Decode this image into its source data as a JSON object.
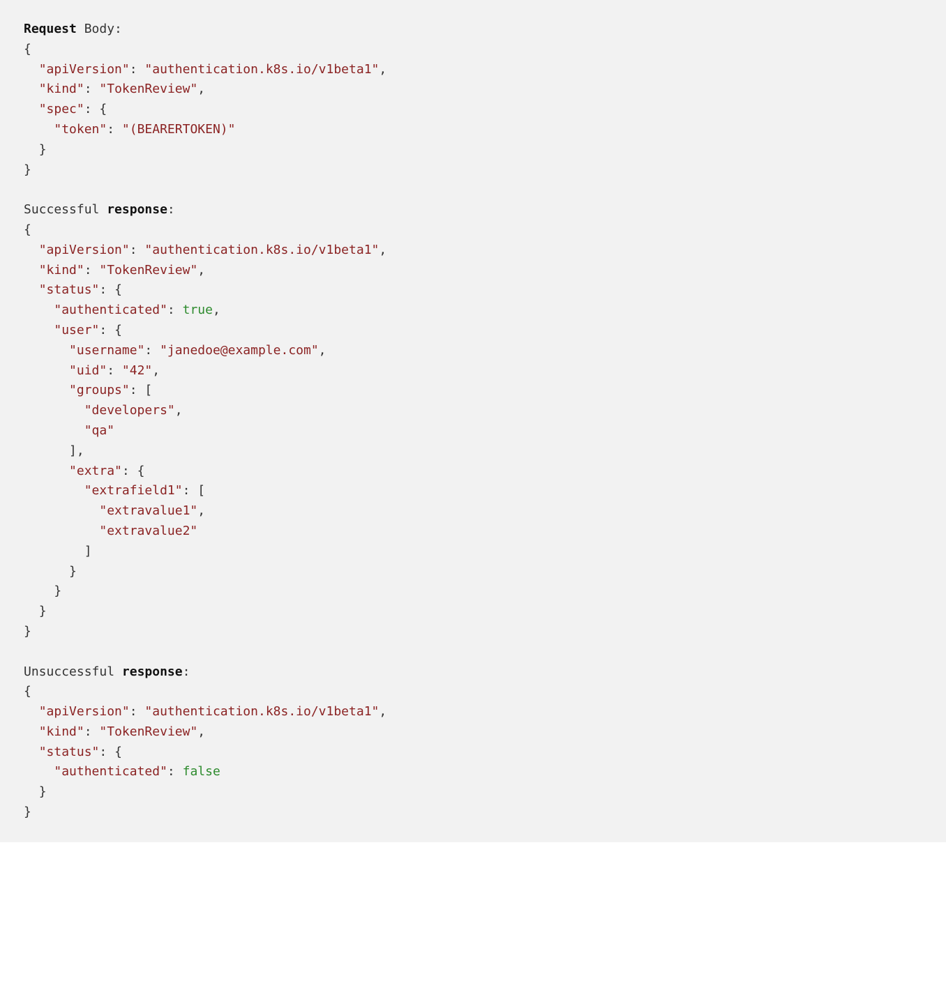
{
  "header1_bold": "Request",
  "header1_rest": " Body:",
  "header2_pre": "Successful ",
  "header2_bold": "response",
  "header2_post": ":",
  "header3_pre": "Unsuccessful ",
  "header3_bold": "response",
  "header3_post": ":",
  "keys": {
    "apiVersion": "\"apiVersion\"",
    "kind": "\"kind\"",
    "spec": "\"spec\"",
    "token": "\"token\"",
    "status": "\"status\"",
    "authenticated": "\"authenticated\"",
    "user": "\"user\"",
    "username": "\"username\"",
    "uid": "\"uid\"",
    "groups": "\"groups\"",
    "extra": "\"extra\"",
    "extrafield1": "\"extrafield1\""
  },
  "vals": {
    "apiVersion": "\"authentication.k8s.io/v1beta1\"",
    "kind": "\"TokenReview\"",
    "token": "\"(BEARERTOKEN)\"",
    "true": "true",
    "false": "false",
    "username": "\"janedoe@example.com\"",
    "uid": "\"42\"",
    "group1": "\"developers\"",
    "group2": "\"qa\"",
    "extravalue1": "\"extravalue1\"",
    "extravalue2": "\"extravalue2\""
  },
  "p": {
    "ob": "{",
    "cb": "}",
    "osb": "[",
    "csb": "]",
    "colonspace": ": ",
    "comma": ","
  }
}
